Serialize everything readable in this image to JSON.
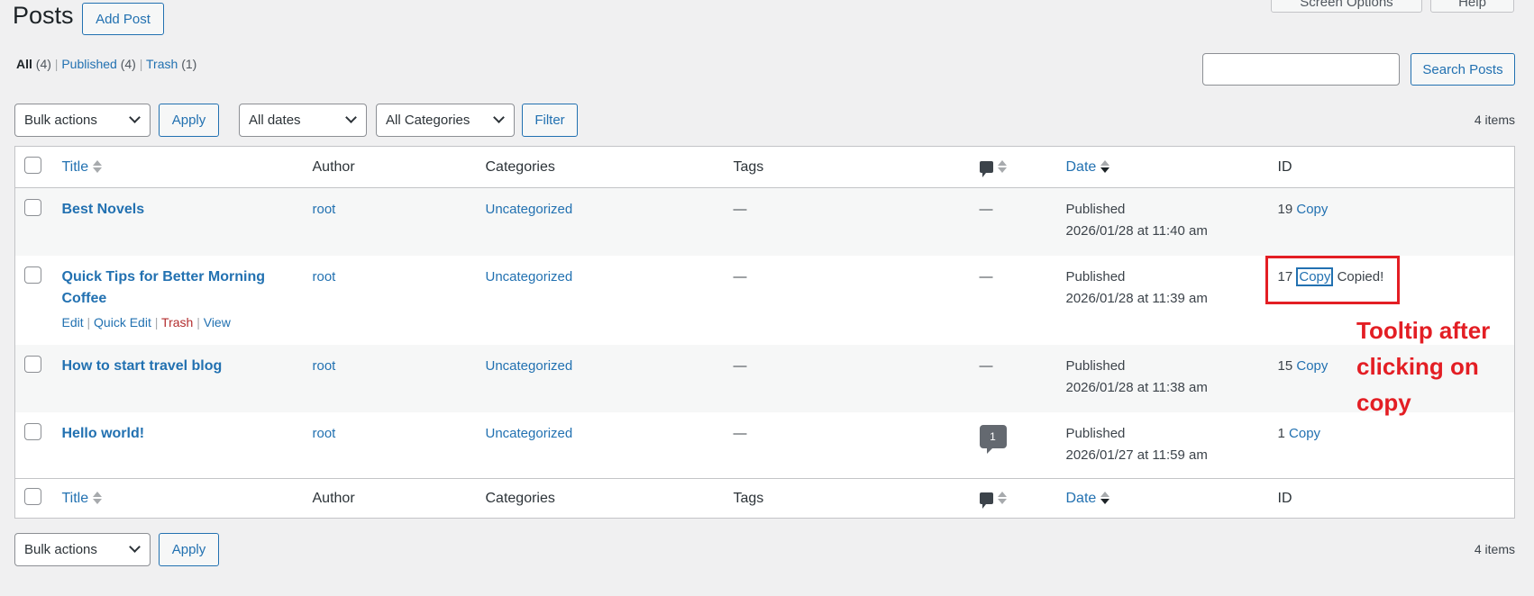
{
  "header": {
    "title": "Posts",
    "add_post": "Add Post",
    "screen_options": "Screen Options",
    "help": "Help"
  },
  "filters": {
    "all": "All",
    "all_count": "(4)",
    "published": "Published",
    "published_count": "(4)",
    "trash": "Trash",
    "trash_count": "(1)"
  },
  "search": {
    "value": "",
    "button": "Search Posts"
  },
  "toolbar": {
    "bulk_actions": "Bulk actions",
    "apply": "Apply",
    "dates": "All dates",
    "categories": "All Categories",
    "filter": "Filter",
    "items": "4 items"
  },
  "columns": {
    "title": "Title",
    "author": "Author",
    "categories": "Categories",
    "tags": "Tags",
    "date": "Date",
    "id": "ID"
  },
  "rows": [
    {
      "title": "Best Novels",
      "author": "root",
      "category": "Uncategorized",
      "tags": "—",
      "comments": "—",
      "status": "Published",
      "date": "2026/01/28 at 11:40 am",
      "id": "19",
      "copy": "Copy"
    },
    {
      "title": "Quick Tips for Better Morning Coffee",
      "author": "root",
      "category": "Uncategorized",
      "tags": "—",
      "comments": "—",
      "status": "Published",
      "date": "2026/01/28 at 11:39 am",
      "id": "17",
      "copy": "Copy",
      "copied": "Copied!",
      "actions": {
        "edit": "Edit",
        "quick_edit": "Quick Edit",
        "trash": "Trash",
        "view": "View"
      }
    },
    {
      "title": "How to start travel blog",
      "author": "root",
      "category": "Uncategorized",
      "tags": "—",
      "comments": "—",
      "status": "Published",
      "date": "2026/01/28 at 11:38 am",
      "id": "15",
      "copy": "Copy"
    },
    {
      "title": "Hello world!",
      "author": "root",
      "category": "Uncategorized",
      "tags": "—",
      "comments": "1",
      "status": "Published",
      "date": "2026/01/27 at 11:59 am",
      "id": "1",
      "copy": "Copy"
    }
  ],
  "annotation": {
    "line1": "Tooltip after",
    "line2": "clicking on",
    "line3": "copy",
    "color": "#e31e24"
  }
}
